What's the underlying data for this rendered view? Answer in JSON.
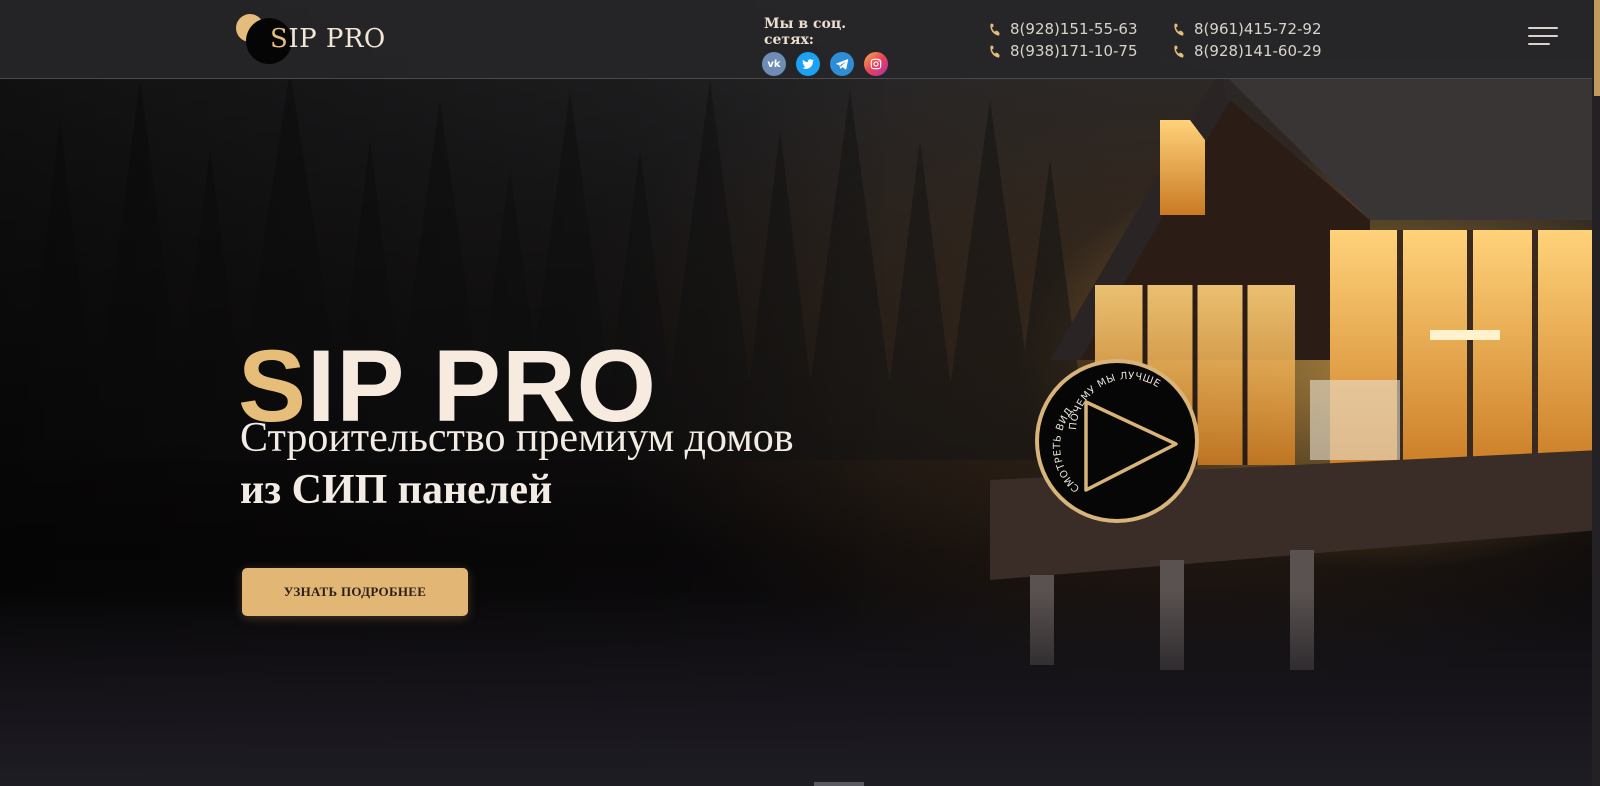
{
  "header": {
    "logo": {
      "accent": "S",
      "text": "IP PRO"
    },
    "social": {
      "title": "Мы в соц. сетях:",
      "icons": [
        "vk-icon",
        "twitter-icon",
        "telegram-icon",
        "instagram-icon"
      ]
    },
    "phones": [
      [
        "8(928)151-55-63",
        "8(961)415-72-92"
      ],
      [
        "8(938)171-10-75",
        "8(928)141-60-29"
      ]
    ],
    "menu_icon": "hamburger-menu-icon"
  },
  "hero": {
    "title_accent": "S",
    "title_rest": "IP PRO",
    "subtitle_line1": "Строительство премиум домов",
    "subtitle_line2": "из СИП панелей",
    "cta_label": "УЗНАТЬ ПОДРОБНЕЕ"
  },
  "video_badge": {
    "top_text": "ПОЧЕМУ МЫ ЛУЧШЕ",
    "side_text": "СМОТРЕТЬ ВИДЕО",
    "icon": "play-icon"
  },
  "colors": {
    "accent_gold": "#e4bc7c",
    "header_bg": "#262628",
    "text_light": "#f3ece4"
  }
}
